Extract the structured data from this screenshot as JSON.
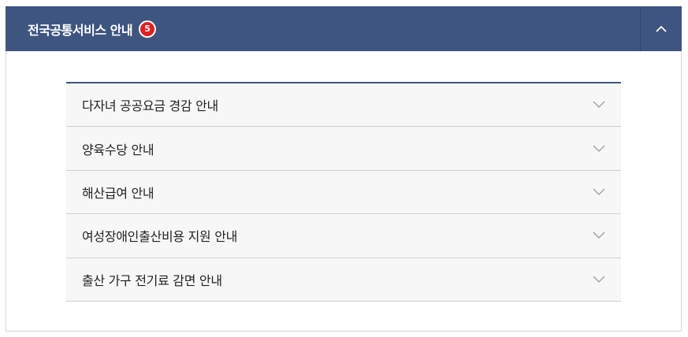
{
  "header": {
    "title": "전국공통서비스 안내",
    "badge_count": "5",
    "collapse_icon": "chevron-up-icon"
  },
  "accordion": {
    "items": [
      {
        "label": "다자녀 공공요금 경감 안내"
      },
      {
        "label": "양육수당 안내"
      },
      {
        "label": "해산급여 안내"
      },
      {
        "label": "여성장애인출산비용 지원 안내"
      },
      {
        "label": "출산 가구 전기료 감면 안내"
      }
    ],
    "item_icon": "chevron-down-icon"
  },
  "colors": {
    "header_bg": "#3e5580",
    "badge_bg": "#e02020",
    "item_bg": "#f7f7f7"
  }
}
